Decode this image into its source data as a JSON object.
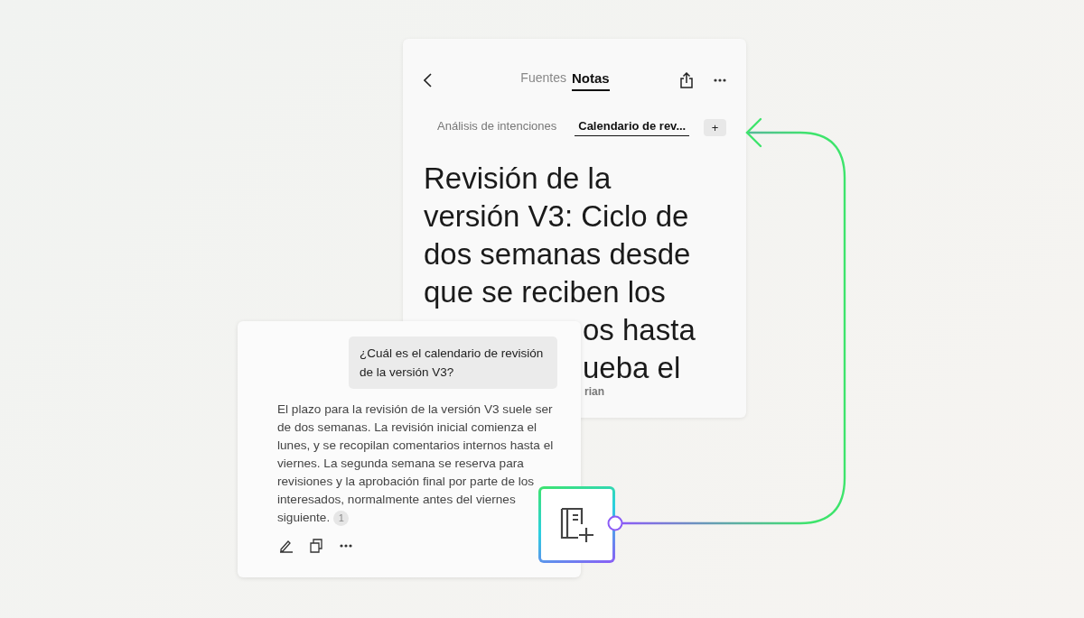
{
  "notes_panel": {
    "tabs": [
      {
        "label": "Fuentes",
        "selected": false
      },
      {
        "label": "Notas",
        "selected": true
      }
    ],
    "note_tabs": [
      {
        "label": "Análisis de intenciones",
        "selected": false
      },
      {
        "label": "Calendario de rev...",
        "selected": true
      }
    ],
    "add_tab": "+",
    "title_lines": [
      "Revisión de la",
      "versión V3: Ciclo de",
      "dos semanas desde",
      "que se reciben los"
    ],
    "title_fragments": [
      "os hasta",
      "ueba el"
    ],
    "meta_fragment": "rian"
  },
  "chat_panel": {
    "question": "¿Cuál es el calendario de revisión de la versión V3?",
    "answer": "El plazo para la revisión de la versión V3 suele ser de dos semanas. La revisión inicial comienza el lunes, y se recopilan comentarios internos hasta el viernes. La segunda semana se reserva para revisiones y la aprobación final por parte de los interesados, normalmente antes del viernes siguiente.",
    "citation": "1"
  }
}
